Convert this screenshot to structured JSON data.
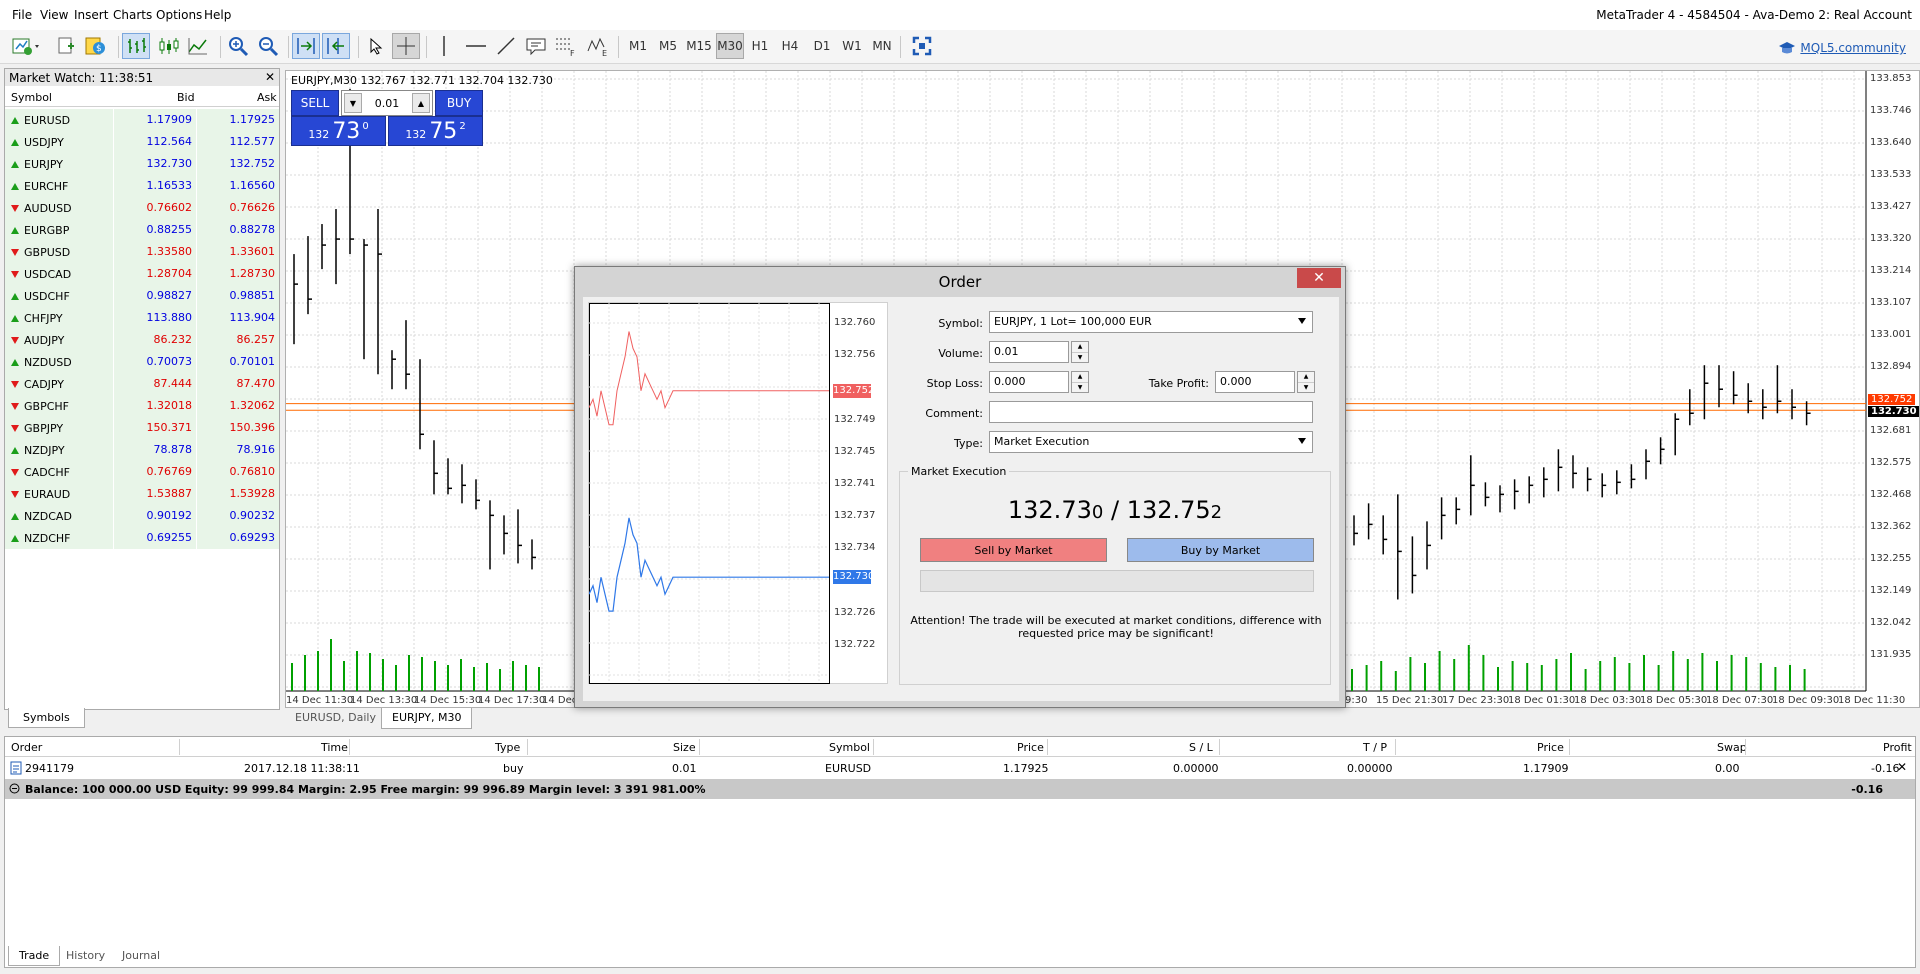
{
  "window_title": "MetaTrader 4 - 4584504 - Ava-Demo 2: Real Account",
  "menu": [
    "File",
    "View",
    "Insert",
    "Charts",
    "Options",
    "Help"
  ],
  "toolbar": {
    "timeframes": [
      "M1",
      "M5",
      "M15",
      "M30",
      "H1",
      "H4",
      "D1",
      "W1",
      "MN"
    ],
    "active_timeframe": "M30",
    "community_link": "MQL5.community"
  },
  "market_watch": {
    "title": "Market Watch: 11:38:51",
    "columns": [
      "Symbol",
      "Bid",
      "Ask"
    ],
    "rows": [
      {
        "symbol": "EURUSD",
        "bid": "1.17909",
        "ask": "1.17925",
        "dir": "up",
        "color": "blue"
      },
      {
        "symbol": "USDJPY",
        "bid": "112.564",
        "ask": "112.577",
        "dir": "up",
        "color": "blue"
      },
      {
        "symbol": "EURJPY",
        "bid": "132.730",
        "ask": "132.752",
        "dir": "up",
        "color": "blue"
      },
      {
        "symbol": "EURCHF",
        "bid": "1.16533",
        "ask": "1.16560",
        "dir": "up",
        "color": "blue"
      },
      {
        "symbol": "AUDUSD",
        "bid": "0.76602",
        "ask": "0.76626",
        "dir": "down",
        "color": "red"
      },
      {
        "symbol": "EURGBP",
        "bid": "0.88255",
        "ask": "0.88278",
        "dir": "up",
        "color": "blue"
      },
      {
        "symbol": "GBPUSD",
        "bid": "1.33580",
        "ask": "1.33601",
        "dir": "down",
        "color": "red"
      },
      {
        "symbol": "USDCAD",
        "bid": "1.28704",
        "ask": "1.28730",
        "dir": "down",
        "color": "red"
      },
      {
        "symbol": "USDCHF",
        "bid": "0.98827",
        "ask": "0.98851",
        "dir": "up",
        "color": "blue"
      },
      {
        "symbol": "CHFJPY",
        "bid": "113.880",
        "ask": "113.904",
        "dir": "up",
        "color": "blue"
      },
      {
        "symbol": "AUDJPY",
        "bid": "86.232",
        "ask": "86.257",
        "dir": "down",
        "color": "red"
      },
      {
        "symbol": "NZDUSD",
        "bid": "0.70073",
        "ask": "0.70101",
        "dir": "up",
        "color": "blue"
      },
      {
        "symbol": "CADJPY",
        "bid": "87.444",
        "ask": "87.470",
        "dir": "down",
        "color": "red"
      },
      {
        "symbol": "GBPCHF",
        "bid": "1.32018",
        "ask": "1.32062",
        "dir": "down",
        "color": "red"
      },
      {
        "symbol": "GBPJPY",
        "bid": "150.371",
        "ask": "150.396",
        "dir": "down",
        "color": "red"
      },
      {
        "symbol": "NZDJPY",
        "bid": "78.878",
        "ask": "78.916",
        "dir": "up",
        "color": "blue"
      },
      {
        "symbol": "CADCHF",
        "bid": "0.76769",
        "ask": "0.76810",
        "dir": "down",
        "color": "red"
      },
      {
        "symbol": "EURAUD",
        "bid": "1.53887",
        "ask": "1.53928",
        "dir": "down",
        "color": "red"
      },
      {
        "symbol": "NZDCAD",
        "bid": "0.90192",
        "ask": "0.90232",
        "dir": "up",
        "color": "blue"
      },
      {
        "symbol": "NZDCHF",
        "bid": "0.69255",
        "ask": "0.69293",
        "dir": "up",
        "color": "blue"
      }
    ],
    "tab": "Symbols"
  },
  "chart": {
    "header": "EURJPY,M30  132.767 132.771 132.704 132.730",
    "price_labels": [
      "133.853",
      "133.746",
      "133.640",
      "133.533",
      "133.427",
      "133.320",
      "133.214",
      "133.107",
      "133.001",
      "132.894",
      "132.788",
      "132.681",
      "132.575",
      "132.468",
      "132.362",
      "132.255",
      "132.149",
      "132.042",
      "131.935"
    ],
    "current_price": "132.730",
    "ask_price_partial": "132.752",
    "time_labels_left": [
      "14 Dec 11:30",
      "14 Dec 13:30",
      "14 Dec 15:30",
      "14 Dec 17:30",
      "14 Dec"
    ],
    "time_labels_right": [
      "9:30",
      "15 Dec 21:30",
      "17 Dec 23:30",
      "18 Dec 01:30",
      "18 Dec 03:30",
      "18 Dec 05:30",
      "18 Dec 07:30",
      "18 Dec 09:30",
      "18 Dec 11:30"
    ],
    "tabs": [
      "EURUSD, Daily",
      "EURJPY, M30"
    ],
    "active_tab": "EURJPY, M30",
    "colors": {
      "bid_line": "#ff6a00",
      "ask_line": "#ff0000",
      "volume": "#00a000"
    }
  },
  "one_click": {
    "sell_label": "SELL",
    "buy_label": "BUY",
    "lot": "0.01",
    "sell_small": "132",
    "sell_big": "73",
    "sell_sup": "0",
    "buy_small": "132",
    "buy_big": "75",
    "buy_sup": "2"
  },
  "order_dialog": {
    "title": "Order",
    "symbol_label": "Symbol:",
    "symbol_value": "EURJPY, 1 Lot= 100,000 EUR",
    "volume_label": "Volume:",
    "volume_value": "0.01",
    "stop_loss_label": "Stop Loss:",
    "stop_loss_value": "0.000",
    "take_profit_label": "Take Profit:",
    "take_profit_value": "0.000",
    "comment_label": "Comment:",
    "comment_value": "",
    "type_label": "Type:",
    "type_value": "Market Execution",
    "group_label": "Market Execution",
    "bid_main": "132.73",
    "bid_last": "0",
    "separator": "/",
    "ask_main": "132.75",
    "ask_last": "2",
    "sell_button": "Sell by Market",
    "buy_button": "Buy by Market",
    "note": "Attention! The trade will be executed at market conditions, difference with requested price may be significant!",
    "tick_labels": [
      "132.760",
      "132.756",
      "132.752",
      "132.749",
      "132.745",
      "132.741",
      "132.737",
      "132.734",
      "132.730",
      "132.726",
      "132.722"
    ],
    "ask_badge": "132.752",
    "bid_badge": "132.730",
    "colors": {
      "ask_line": "#f06060",
      "bid_line": "#2f78e8"
    }
  },
  "terminal": {
    "columns": [
      "Order",
      "Time",
      "Type",
      "Size",
      "Symbol",
      "Price",
      "S / L",
      "T / P",
      "Price",
      "Swap",
      "Profit"
    ],
    "row": {
      "order": "2941179",
      "time": "2017.12.18 11:38:11",
      "type": "buy",
      "size": "0.01",
      "symbol": "EURUSD",
      "price": "1.17925",
      "sl": "0.00000",
      "tp": "0.00000",
      "cur_price": "1.17909",
      "swap": "0.00",
      "profit": "-0.16"
    },
    "balance_line": "Balance: 100 000.00 USD  Equity: 99 999.84  Margin: 2.95  Free margin: 99 996.89  Margin level: 3 391 981.00%",
    "balance_profit": "-0.16",
    "tabs": [
      "Trade",
      "History",
      "Journal"
    ],
    "active_tab": "Trade"
  }
}
